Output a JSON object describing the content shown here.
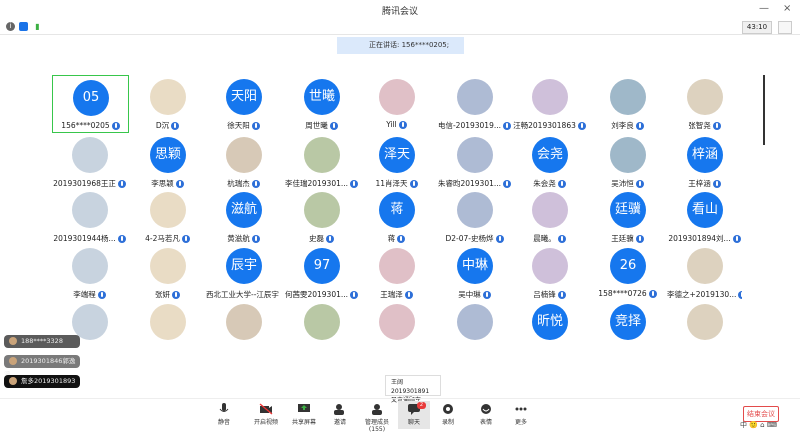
{
  "window": {
    "title": "腾讯会议",
    "minimize": "—",
    "close": "×"
  },
  "status": {
    "timer": "43:10"
  },
  "banner": {
    "speaking": "正在讲话: 156****0205;"
  },
  "participants": [
    {
      "name": "156****0205",
      "avatar": "05",
      "kind": "text"
    },
    {
      "name": "D沉",
      "avatar": "",
      "kind": "img"
    },
    {
      "name": "徐天阳",
      "avatar": "天阳",
      "kind": "text"
    },
    {
      "name": "周世曦",
      "avatar": "世曦",
      "kind": "text"
    },
    {
      "name": "Yill",
      "avatar": "",
      "kind": "img"
    },
    {
      "name": "电信-20193019...",
      "avatar": "",
      "kind": "img"
    },
    {
      "name": "汪畅2019301863",
      "avatar": "",
      "kind": "img"
    },
    {
      "name": "刘李良",
      "avatar": "",
      "kind": "img"
    },
    {
      "name": "张智尧",
      "avatar": "",
      "kind": "img"
    },
    {
      "name": "2019301968王正",
      "avatar": "",
      "kind": "img"
    },
    {
      "name": "李思颖",
      "avatar": "思颖",
      "kind": "text"
    },
    {
      "name": "杭瑞杰",
      "avatar": "",
      "kind": "img"
    },
    {
      "name": "李佳瑞2019301...",
      "avatar": "",
      "kind": "img"
    },
    {
      "name": "11肖泽天",
      "avatar": "泽天",
      "kind": "text"
    },
    {
      "name": "朱睿昀2019301...",
      "avatar": "",
      "kind": "img"
    },
    {
      "name": "朱会尧",
      "avatar": "会尧",
      "kind": "text"
    },
    {
      "name": "吴沛恒",
      "avatar": "",
      "kind": "img"
    },
    {
      "name": "王梓涵",
      "avatar": "梓涵",
      "kind": "text"
    },
    {
      "name": "2019301944杨...",
      "avatar": "",
      "kind": "img"
    },
    {
      "name": "4-2马若凡",
      "avatar": "",
      "kind": "img"
    },
    {
      "name": "黄滋航",
      "avatar": "滋航",
      "kind": "text"
    },
    {
      "name": "史磊",
      "avatar": "",
      "kind": "img"
    },
    {
      "name": "蒋",
      "avatar": "蒋",
      "kind": "text"
    },
    {
      "name": "D2-07-史杨烨",
      "avatar": "",
      "kind": "img"
    },
    {
      "name": "晨曦。",
      "avatar": "",
      "kind": "img"
    },
    {
      "name": "王廷骥",
      "avatar": "廷骥",
      "kind": "text"
    },
    {
      "name": "2019301894刘...",
      "avatar": "看山",
      "kind": "text"
    },
    {
      "name": "李端程",
      "avatar": "",
      "kind": "img"
    },
    {
      "name": "张妍",
      "avatar": "",
      "kind": "img"
    },
    {
      "name": "西北工业大学--江辰宇",
      "avatar": "辰宇",
      "kind": "text"
    },
    {
      "name": "何茜雯2019301...",
      "avatar": "97",
      "kind": "text"
    },
    {
      "name": "王瑞泽",
      "avatar": "",
      "kind": "img"
    },
    {
      "name": "吴中琳",
      "avatar": "中琳",
      "kind": "text"
    },
    {
      "name": "吕楠锋",
      "avatar": "",
      "kind": "img"
    },
    {
      "name": "158****0726",
      "avatar": "26",
      "kind": "text"
    },
    {
      "name": "李德之+2019130...",
      "avatar": "",
      "kind": "img"
    },
    {
      "name": "",
      "avatar": "",
      "kind": "img"
    },
    {
      "name": "",
      "avatar": "",
      "kind": "img"
    },
    {
      "name": "",
      "avatar": "",
      "kind": "img"
    },
    {
      "name": "",
      "avatar": "",
      "kind": "img"
    },
    {
      "name": "",
      "avatar": "",
      "kind": "img"
    },
    {
      "name": "",
      "avatar": "",
      "kind": "img"
    },
    {
      "name": "",
      "avatar": "昕悦",
      "kind": "text"
    },
    {
      "name": "",
      "avatar": "竞择",
      "kind": "text"
    },
    {
      "name": "",
      "avatar": "",
      "kind": "img"
    }
  ],
  "messages": [
    "188****3328",
    "2019301846郭逸涵",
    "詹多2019301893"
  ],
  "tooltip": {
    "line1": "王阔 2019301891",
    "line2": "又弯通顾车"
  },
  "toolbar": {
    "mute": "静音",
    "video": "开启视频",
    "share": "共享屏幕",
    "invite": "邀请",
    "members": "管理成员(155)",
    "chat": "聊天",
    "chat_badge": "2",
    "record": "录制",
    "reactions": "表情",
    "more": "更多"
  },
  "end_button": "结束会议",
  "tray": "中 🙂 ⌂ ⌨"
}
